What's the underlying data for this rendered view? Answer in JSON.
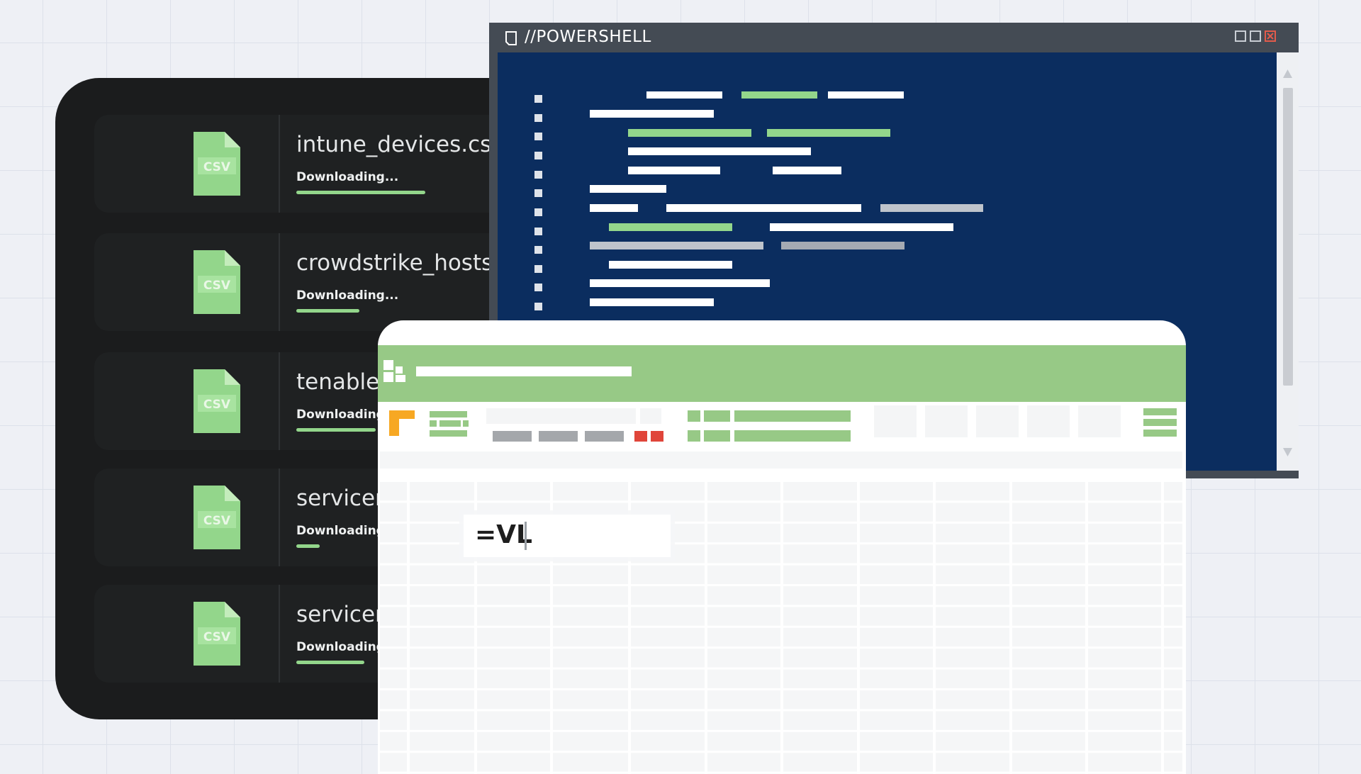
{
  "downloads": {
    "items": [
      {
        "filename": "intune_devices.csv",
        "icon_label": "CSV",
        "status": "Downloading...",
        "progress": 0.55
      },
      {
        "filename": "crowdstrike_hosts.xlsx",
        "icon_label": "CSV",
        "status": "Downloading...",
        "progress": 0.27
      },
      {
        "filename": "tenable_exp",
        "icon_label": "CSV",
        "status": "Downloading...",
        "progress": 0.34
      },
      {
        "filename": "servicenow",
        "icon_label": "CSV",
        "status": "Downloading...",
        "progress": 0.1
      },
      {
        "filename": "servicenow",
        "icon_label": "CSV",
        "status": "Downloading...",
        "progress": 0.29
      }
    ]
  },
  "powershell": {
    "title": "//POWERSHELL",
    "controls": [
      "minimize-icon",
      "maximize-icon",
      "close-icon"
    ]
  },
  "spreadsheet": {
    "formula_input": "=VL"
  },
  "colors": {
    "accent_green": "#93d68b",
    "ps_background": "#0b2d5f",
    "sheet_header": "#97c986",
    "close_red": "#e25b4b",
    "highlight_orange": "#f7a823",
    "alert_red": "#e0453a"
  }
}
